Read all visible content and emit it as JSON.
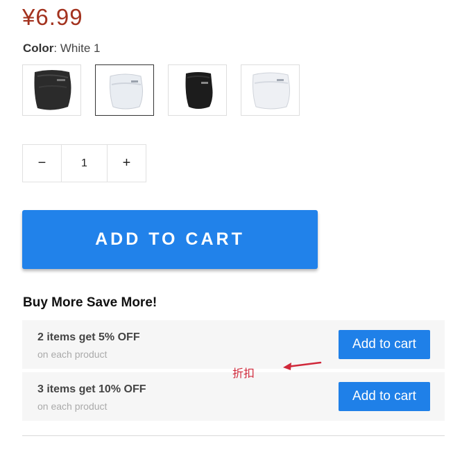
{
  "product": {
    "price": "¥6.99",
    "color_label": "Color",
    "color_value": "White 1",
    "swatches": [
      {
        "name": "Black 1",
        "color": "#2a2a2a",
        "selected": false
      },
      {
        "name": "White 1",
        "color": "#e9edf2",
        "selected": true
      },
      {
        "name": "Black 2",
        "color": "#1a1a1a",
        "selected": false
      },
      {
        "name": "White 2",
        "color": "#eef0f4",
        "selected": false
      }
    ]
  },
  "quantity": {
    "decrement_label": "−",
    "value": "1",
    "increment_label": "+"
  },
  "cart": {
    "add_to_cart_label": "ADD TO CART"
  },
  "bulk": {
    "title": "Buy More Save More!",
    "offers": [
      {
        "title": "2 items get 5% OFF",
        "subtitle": "on each product",
        "button": "Add to cart"
      },
      {
        "title": "3 items get 10% OFF",
        "subtitle": "on each product",
        "button": "Add to cart"
      }
    ]
  },
  "annotation": {
    "text": "折扣",
    "color": "#d0283a"
  },
  "colors": {
    "price": "#a3321e",
    "accent": "#2182ea"
  }
}
